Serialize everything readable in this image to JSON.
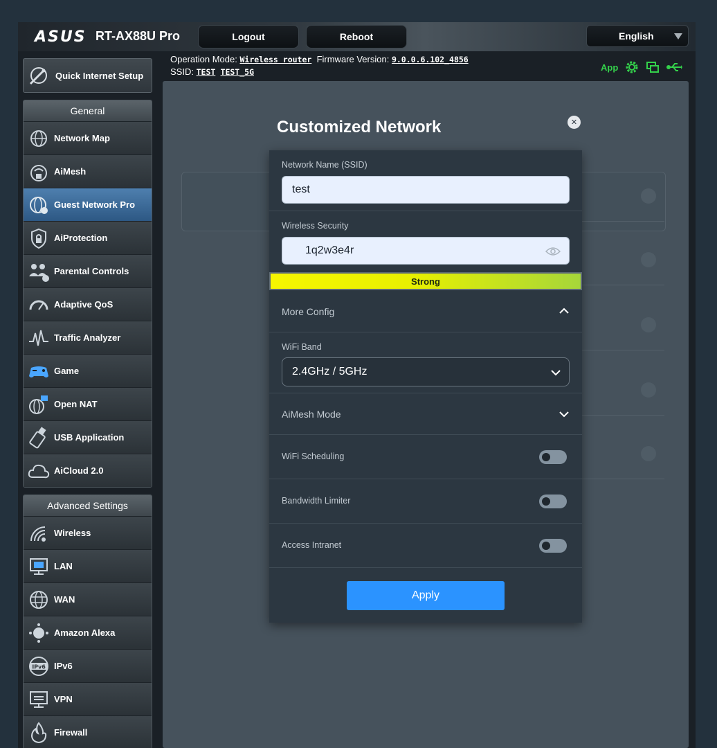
{
  "header": {
    "brand": "ASUS",
    "model": "RT-AX88U Pro",
    "logout_label": "Logout",
    "reboot_label": "Reboot",
    "language": "English"
  },
  "info": {
    "operation_mode_label": "Operation Mode:",
    "operation_mode_value": "Wireless router",
    "firmware_label": "Firmware Version:",
    "firmware_value": "9.0.0.6.102_4856",
    "ssid_label": "SSID:",
    "ssid_values": [
      "TEST",
      "TEST_5G"
    ],
    "app_label": "App"
  },
  "sidebar": {
    "qis_label": "Quick Internet Setup",
    "general_title": "General",
    "general_items": [
      {
        "label": "Network Map",
        "icon": "globe-icon"
      },
      {
        "label": "AiMesh",
        "icon": "aimesh-icon"
      },
      {
        "label": "Guest Network Pro",
        "icon": "guest-network-icon",
        "active": true
      },
      {
        "label": "AiProtection",
        "icon": "shield-lock-icon"
      },
      {
        "label": "Parental Controls",
        "icon": "family-icon"
      },
      {
        "label": "Adaptive QoS",
        "icon": "gauge-icon"
      },
      {
        "label": "Traffic Analyzer",
        "icon": "pulse-icon"
      },
      {
        "label": "Game",
        "icon": "gamepad-icon"
      },
      {
        "label": "Open NAT",
        "icon": "open-nat-icon"
      },
      {
        "label": "USB Application",
        "icon": "usb-stick-icon"
      },
      {
        "label": "AiCloud 2.0",
        "icon": "cloud-icon"
      }
    ],
    "advanced_title": "Advanced Settings",
    "advanced_items": [
      {
        "label": "Wireless",
        "icon": "wifi-icon"
      },
      {
        "label": "LAN",
        "icon": "lan-monitor-icon"
      },
      {
        "label": "WAN",
        "icon": "wan-globe-icon"
      },
      {
        "label": "Amazon Alexa",
        "icon": "alexa-icon"
      },
      {
        "label": "IPv6",
        "icon": "ipv6-icon"
      },
      {
        "label": "VPN",
        "icon": "vpn-monitor-icon"
      },
      {
        "label": "Firewall",
        "icon": "fire-icon"
      }
    ]
  },
  "modal": {
    "title": "Customized Network",
    "ssid_label": "Network Name (SSID)",
    "ssid_value": "test",
    "security_label": "Wireless Security",
    "password_value": "1q2w3e4r",
    "strength": "Strong",
    "more_config_label": "More Config",
    "wifi_band_label": "WiFi Band",
    "wifi_band_value": "2.4GHz / 5GHz",
    "aimesh_mode_label": "AiMesh Mode",
    "wifi_scheduling_label": "WiFi Scheduling",
    "bandwidth_limiter_label": "Bandwidth Limiter",
    "access_intranet_label": "Access Intranet",
    "apply_label": "Apply"
  },
  "colors": {
    "accent_blue": "#2b93ff",
    "active_menu": "#3d6c9c",
    "status_green": "#34d14b",
    "strength_yellow": "#f6f600"
  }
}
